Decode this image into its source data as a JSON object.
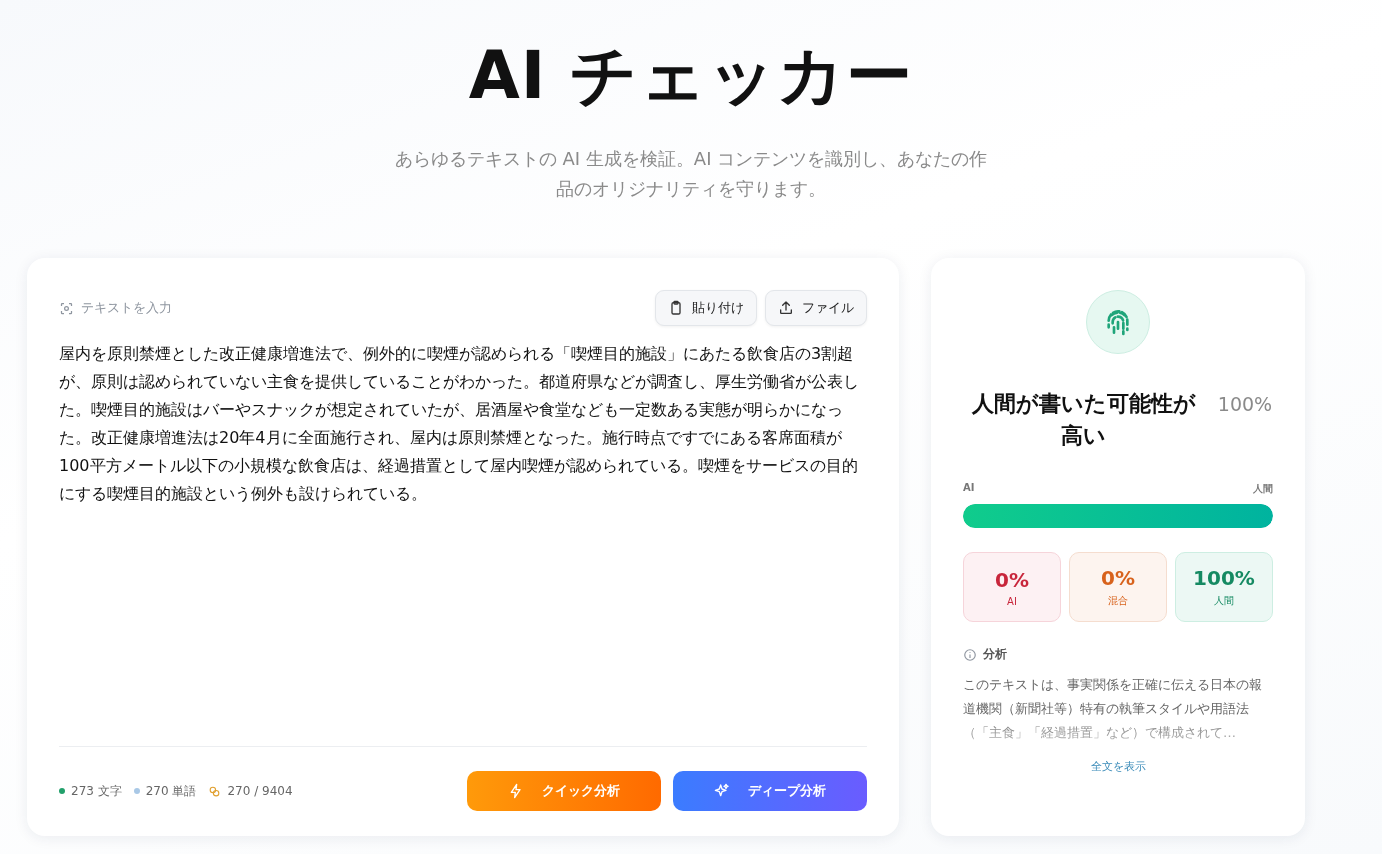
{
  "header": {
    "title": "AI チェッカー",
    "subtitle": "あらゆるテキストの AI 生成を検証。AI コンテンツを識別し、あなたの作品のオリジナリティを守ります。"
  },
  "editor": {
    "label": "テキストを入力",
    "buttons": [
      {
        "kind": "paste",
        "label": "貼り付け"
      },
      {
        "kind": "upload",
        "label": "ファイル"
      }
    ],
    "value": "屋内を原則禁煙とした改正健康増進法で、例外的に喫煙が認められる「喫煙目的施設」にあたる飲食店の3割超が、原則は認められていない主食を提供していることがわかった。都道府県などが調査し、厚生労働省が公表した。喫煙目的施設はバーやスナックが想定されていたが、居酒屋や食堂なども一定数ある実態が明らかになった。改正健康増進法は20年4月に全面施行され、屋内は原則禁煙となった。施行時点ですでにある客席面積が100平方メートル以下の小規模な飲食店は、経過措置として屋内喫煙が認められている。喫煙をサービスの目的にする喫煙目的施設という例外も設けられている。",
    "stats": [
      {
        "text": "273 文字",
        "color": "#22a06b"
      },
      {
        "text": "270 単語",
        "color": "#a9c8e6"
      },
      {
        "kind": "coins",
        "text": "270 / 9404"
      }
    ],
    "actions": [
      {
        "kind": "quick",
        "label": "クイック分析"
      },
      {
        "kind": "deep",
        "label": "ディープ分析"
      }
    ]
  },
  "result": {
    "verdict": "人間が書いた可能性が高い",
    "score": "100%",
    "scale_left": "AI",
    "scale_right": "人間",
    "level": 1,
    "breakdown": [
      {
        "kind": "ai",
        "value": "0%",
        "label": "AI"
      },
      {
        "kind": "mixed",
        "value": "0%",
        "label": "混合"
      },
      {
        "kind": "human",
        "value": "100%",
        "label": "人間"
      }
    ],
    "analysis_title": "分析",
    "analysis": "このテキストは、事実関係を正確に伝える日本の報道機関（新聞社等）特有の執筆スタイルや用語法（「主食」「経過措置」など）で構成されて…",
    "more_link": "全文を表示"
  }
}
